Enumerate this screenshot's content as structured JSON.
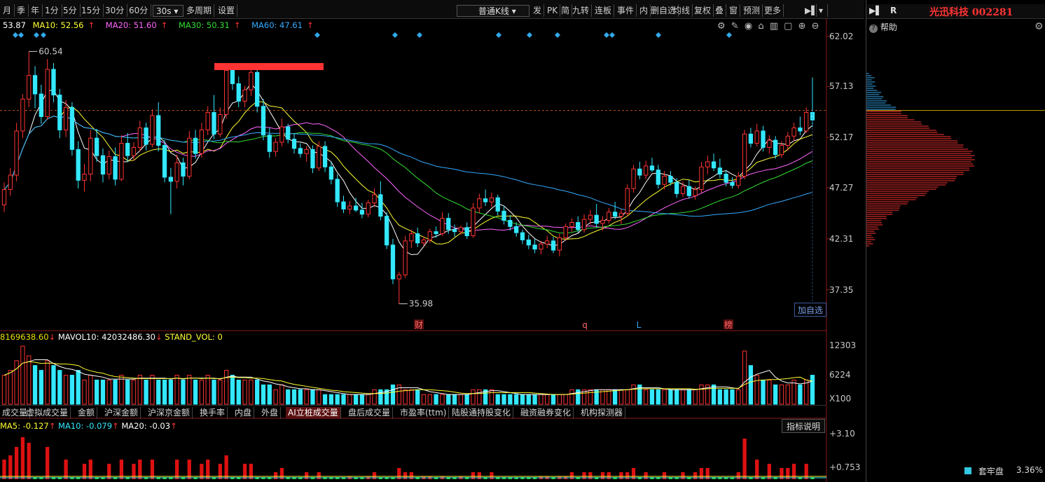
{
  "toolbar": {
    "periods": [
      "月",
      "季",
      "年",
      "1分",
      "5分",
      "15分",
      "30分",
      "60分"
    ],
    "interval_select": "30s",
    "multi_period": "多周期",
    "settings": "设置",
    "kline_type_select": "普通K线",
    "tools": [
      "发",
      "PK",
      "简",
      "九转",
      "连板",
      "事件",
      "内",
      "删自选",
      "均线",
      "复权",
      "叠",
      "窗",
      "预测",
      "更多"
    ]
  },
  "right_panel": {
    "stock_name": "光迅科技 002281",
    "r_label": "R",
    "help_label": "帮助",
    "bottom_items": [
      {
        "label": "套牢盘",
        "value": "3.36%"
      }
    ]
  },
  "ma_line": {
    "price": "53.87",
    "ma10": "MA10: 52.56",
    "ma20": "MA20: 51.60",
    "ma30": "MA30: 50.31",
    "ma60": "MA60: 47.61",
    "arrow": "↑"
  },
  "price_axis": [
    "62.02",
    "57.13",
    "52.17",
    "47.27",
    "42.31",
    "37.35"
  ],
  "annotations": {
    "high": "60.54",
    "low": "35.98",
    "event_markers": [
      "财",
      "q",
      "L",
      "榜"
    ],
    "add_to_watchlist": "加自选"
  },
  "vol_line": {
    "vol": "8169638.60",
    "mavol10": "MAVOL10: 42032486.30",
    "stand_vol": "STAND_VOL: 0"
  },
  "vol_axis": [
    "12303",
    "6224",
    "X100"
  ],
  "indicator_tabs": [
    "成交量",
    "虚拟成交量",
    "金额",
    "沪深金额",
    "沪深京金额",
    "换手率",
    "内盘",
    "外盘",
    "AI立桩成交量",
    "盘后成交量",
    "市盈率(ttm)",
    "陆股通持股变化",
    "融资融券变化",
    "机构探测器"
  ],
  "active_tab_index": 8,
  "indicator_line": {
    "ma5": "MA5: -0.127",
    "ma10": "MA10: -0.079",
    "ma20": "MA20: -0.03",
    "arrow": "↑"
  },
  "indicator_axis": [
    "+3.10",
    "+0.753"
  ],
  "indicator_help": "指标说明",
  "colors": {
    "up": "#ff3333",
    "down": "#33e8ff",
    "ma5": "#ffffff",
    "ma10": "#ffff33",
    "ma20": "#ff66ff",
    "ma30": "#33dd33",
    "ma60": "#33aaff"
  },
  "chart_data": {
    "type": "candlestick",
    "ylim": [
      33.5,
      63.5
    ],
    "last_close": 54.8,
    "candles": [
      [
        45.6,
        47.8,
        44.9,
        47.1
      ],
      [
        47.1,
        49.2,
        46.5,
        48.5
      ],
      [
        48.5,
        53.6,
        47.9,
        52.8
      ],
      [
        52.8,
        56.4,
        52.1,
        55.9
      ],
      [
        55.9,
        60.54,
        55.1,
        58.2
      ],
      [
        58.2,
        59.1,
        55.0,
        56.4
      ],
      [
        56.4,
        57.3,
        53.5,
        54.2
      ],
      [
        54.2,
        59.8,
        53.9,
        58.8
      ],
      [
        58.8,
        59.4,
        55.6,
        56.3
      ],
      [
        56.3,
        56.9,
        52.1,
        52.9
      ],
      [
        52.9,
        55.8,
        52.2,
        55.1
      ],
      [
        55.1,
        55.6,
        50.4,
        51.0
      ],
      [
        51.0,
        51.8,
        47.2,
        48.0
      ],
      [
        48.0,
        49.6,
        46.9,
        48.6
      ],
      [
        48.6,
        52.9,
        47.9,
        52.1
      ],
      [
        52.1,
        53.0,
        49.8,
        50.4
      ],
      [
        50.4,
        51.1,
        47.8,
        48.6
      ],
      [
        48.6,
        50.9,
        48.1,
        50.3
      ],
      [
        50.3,
        51.2,
        47.5,
        48.1
      ],
      [
        48.1,
        52.4,
        47.9,
        51.6
      ],
      [
        51.6,
        52.6,
        49.8,
        50.4
      ],
      [
        50.4,
        51.7,
        49.9,
        51.2
      ],
      [
        51.2,
        53.8,
        50.8,
        53.1
      ],
      [
        53.1,
        53.6,
        50.9,
        51.5
      ],
      [
        51.5,
        54.9,
        51.2,
        54.3
      ],
      [
        54.3,
        55.6,
        50.8,
        51.4
      ],
      [
        51.4,
        51.9,
        47.8,
        48.3
      ],
      [
        48.3,
        49.2,
        44.7,
        47.9
      ],
      [
        47.9,
        50.5,
        47.2,
        49.7
      ],
      [
        49.7,
        50.2,
        47.5,
        48.4
      ],
      [
        48.4,
        52.8,
        48.1,
        52.1
      ],
      [
        52.1,
        52.9,
        50.1,
        50.6
      ],
      [
        50.6,
        53.6,
        50.2,
        52.9
      ],
      [
        52.9,
        55.2,
        52.4,
        54.6
      ],
      [
        54.6,
        56.3,
        52.0,
        52.5
      ],
      [
        52.5,
        55.1,
        52.2,
        54.4
      ],
      [
        54.4,
        59.2,
        54.0,
        58.7
      ],
      [
        58.7,
        59.3,
        56.8,
        57.4
      ],
      [
        57.4,
        58.1,
        55.1,
        55.7
      ],
      [
        55.7,
        57.2,
        55.1,
        56.8
      ],
      [
        56.8,
        59.1,
        56.2,
        58.5
      ],
      [
        58.5,
        58.9,
        54.6,
        55.2
      ],
      [
        55.2,
        55.9,
        51.9,
        52.4
      ],
      [
        52.4,
        53.1,
        50.2,
        50.8
      ],
      [
        50.8,
        52.1,
        50.3,
        51.7
      ],
      [
        51.7,
        54.0,
        51.3,
        53.2
      ],
      [
        53.2,
        53.5,
        51.6,
        52.0
      ],
      [
        52.0,
        52.6,
        50.6,
        51.1
      ],
      [
        51.1,
        51.6,
        50.2,
        50.6
      ],
      [
        50.6,
        51.3,
        49.8,
        51.0
      ],
      [
        51.0,
        51.4,
        48.7,
        49.2
      ],
      [
        49.2,
        51.8,
        48.9,
        51.3
      ],
      [
        51.3,
        51.8,
        48.8,
        49.3
      ],
      [
        49.3,
        49.8,
        47.6,
        48.1
      ],
      [
        48.1,
        48.6,
        45.4,
        45.9
      ],
      [
        45.9,
        46.5,
        44.8,
        45.2
      ],
      [
        45.2,
        46.0,
        44.7,
        45.5
      ],
      [
        45.5,
        46.3,
        44.9,
        45.1
      ],
      [
        45.1,
        45.8,
        44.3,
        44.7
      ],
      [
        44.7,
        46.1,
        44.4,
        45.8
      ],
      [
        45.8,
        47.2,
        45.4,
        46.6
      ],
      [
        46.6,
        47.9,
        44.1,
        44.5
      ],
      [
        44.5,
        44.9,
        41.3,
        41.7
      ],
      [
        41.7,
        42.3,
        37.9,
        38.4
      ],
      [
        38.4,
        39.1,
        35.98,
        38.8
      ],
      [
        38.8,
        42.6,
        38.5,
        42.1
      ],
      [
        42.1,
        43.2,
        41.4,
        42.8
      ],
      [
        42.8,
        43.4,
        41.5,
        41.9
      ],
      [
        41.9,
        42.5,
        41.6,
        42.2
      ],
      [
        42.2,
        43.3,
        41.9,
        43.0
      ],
      [
        43.0,
        43.5,
        42.4,
        42.8
      ],
      [
        42.8,
        44.9,
        42.6,
        44.3
      ],
      [
        44.3,
        44.8,
        42.8,
        43.2
      ],
      [
        43.2,
        43.7,
        42.5,
        43.0
      ],
      [
        43.0,
        43.6,
        42.7,
        43.4
      ],
      [
        43.4,
        43.9,
        42.3,
        42.6
      ],
      [
        42.6,
        45.8,
        42.4,
        45.3
      ],
      [
        45.3,
        46.7,
        44.8,
        46.2
      ],
      [
        46.2,
        47.1,
        45.5,
        45.9
      ],
      [
        45.9,
        46.8,
        45.4,
        46.3
      ],
      [
        46.3,
        46.6,
        44.6,
        45.0
      ],
      [
        45.0,
        45.5,
        43.7,
        44.1
      ],
      [
        44.1,
        44.6,
        43.1,
        43.5
      ],
      [
        43.5,
        43.9,
        42.5,
        42.9
      ],
      [
        42.9,
        43.2,
        41.8,
        42.2
      ],
      [
        42.2,
        42.7,
        41.3,
        41.7
      ],
      [
        41.7,
        42.3,
        40.9,
        41.3
      ],
      [
        41.3,
        42.1,
        40.8,
        41.8
      ],
      [
        41.8,
        42.6,
        41.4,
        42.1
      ],
      [
        42.1,
        42.5,
        40.9,
        41.2
      ],
      [
        41.2,
        42.8,
        40.6,
        42.4
      ],
      [
        42.4,
        43.8,
        42.1,
        43.5
      ],
      [
        43.5,
        44.3,
        43.0,
        43.9
      ],
      [
        43.9,
        44.5,
        42.9,
        43.2
      ],
      [
        43.2,
        44.7,
        42.9,
        44.2
      ],
      [
        44.2,
        45.1,
        43.7,
        44.6
      ],
      [
        44.6,
        45.7,
        43.4,
        43.8
      ],
      [
        43.8,
        44.5,
        43.1,
        44.1
      ],
      [
        44.1,
        45.3,
        43.8,
        44.9
      ],
      [
        44.9,
        45.9,
        44.2,
        44.5
      ],
      [
        44.5,
        45.2,
        43.7,
        44.8
      ],
      [
        44.8,
        47.6,
        44.5,
        47.2
      ],
      [
        47.2,
        49.5,
        46.8,
        49.1
      ],
      [
        49.1,
        49.8,
        48.1,
        48.5
      ],
      [
        48.5,
        49.9,
        48.1,
        49.4
      ],
      [
        49.4,
        50.2,
        48.8,
        49.0
      ],
      [
        49.0,
        49.5,
        47.2,
        47.6
      ],
      [
        47.6,
        48.9,
        47.1,
        48.4
      ],
      [
        48.4,
        48.9,
        47.5,
        47.8
      ],
      [
        47.8,
        48.2,
        46.3,
        46.7
      ],
      [
        46.7,
        47.9,
        46.4,
        47.4
      ],
      [
        47.4,
        48.0,
        46.2,
        46.5
      ],
      [
        46.5,
        47.4,
        46.1,
        47.1
      ],
      [
        47.1,
        49.8,
        46.8,
        49.3
      ],
      [
        49.3,
        50.4,
        48.6,
        49.8
      ],
      [
        49.8,
        50.6,
        48.9,
        49.2
      ],
      [
        49.2,
        50.1,
        48.2,
        48.6
      ],
      [
        48.6,
        49.0,
        47.4,
        47.8
      ],
      [
        47.8,
        48.3,
        47.2,
        47.5
      ],
      [
        47.5,
        48.8,
        47.2,
        48.4
      ],
      [
        48.4,
        52.9,
        48.1,
        52.5
      ],
      [
        52.5,
        53.1,
        51.2,
        51.6
      ],
      [
        51.6,
        53.5,
        51.3,
        52.8
      ],
      [
        52.8,
        53.3,
        50.8,
        51.2
      ],
      [
        51.2,
        52.4,
        50.6,
        51.9
      ],
      [
        51.9,
        52.3,
        50.1,
        50.5
      ],
      [
        50.5,
        51.8,
        50.2,
        51.4
      ],
      [
        51.4,
        52.7,
        50.9,
        52.3
      ],
      [
        52.3,
        53.6,
        51.8,
        53.1
      ],
      [
        53.1,
        54.2,
        52.4,
        52.8
      ],
      [
        52.8,
        55.1,
        52.6,
        54.6
      ],
      [
        54.6,
        58.0,
        53.2,
        53.87
      ]
    ],
    "volume": [
      6,
      7,
      9,
      12,
      10,
      8,
      7,
      9,
      8,
      7,
      6,
      6,
      7,
      5,
      6,
      5,
      5,
      5,
      5,
      6,
      5,
      5,
      6,
      5,
      6,
      5,
      5,
      5,
      6,
      5,
      6,
      5,
      5,
      6,
      5,
      5,
      7,
      6,
      5,
      5,
      5,
      5,
      4,
      4,
      3,
      4,
      3,
      3,
      3,
      3,
      3,
      3,
      2,
      2,
      2,
      2,
      2,
      2,
      2,
      2,
      3,
      3,
      3,
      4,
      4,
      3,
      3,
      3,
      2,
      2,
      2,
      2,
      2,
      2,
      2,
      2,
      3,
      3,
      3,
      3,
      2,
      2,
      2,
      2,
      2,
      2,
      2,
      2,
      2,
      2,
      2,
      2,
      3,
      3,
      3,
      3,
      3,
      3,
      3,
      3,
      3,
      3,
      4,
      4,
      3,
      3,
      3,
      3,
      3,
      3,
      3,
      3,
      3,
      4,
      4,
      4,
      3,
      3,
      3,
      3,
      11,
      8,
      6,
      5,
      5,
      4,
      4,
      4,
      5,
      4,
      5,
      6
    ],
    "vol_ylim": [
      0,
      12.303
    ]
  }
}
